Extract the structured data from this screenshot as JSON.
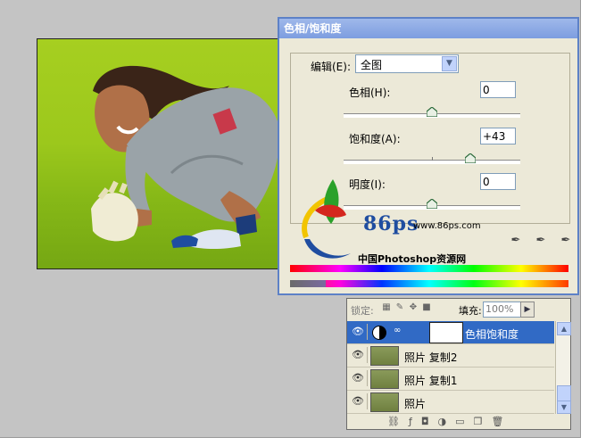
{
  "dialog": {
    "title": "色相/饱和度",
    "edit_label": "编辑(E):",
    "edit_value": "全图",
    "hue_label": "色相(H):",
    "hue_value": "0",
    "hue_level": 0,
    "saturation_label": "饱和度(A):",
    "saturation_value": "+43",
    "saturation_level": 43,
    "lightness_label": "明度(I):",
    "lightness_value": "0",
    "lightness_level": 0
  },
  "watermark": {
    "brand": "86ps",
    "url": "www.86ps.com",
    "tagline": "中国Photoshop资源网"
  },
  "layers_panel": {
    "lock_label": "锁定:",
    "fill_label": "填充:",
    "fill_value": "100%",
    "layers": [
      {
        "name": "色相饱和度",
        "selected": true,
        "type": "adjustment"
      },
      {
        "name": "照片 复制2",
        "selected": false,
        "type": "image"
      },
      {
        "name": "照片 复制1",
        "selected": false,
        "type": "image"
      },
      {
        "name": "照片",
        "selected": false,
        "type": "image"
      }
    ]
  },
  "colors": {
    "title_bar": "#7d9de0",
    "selection": "#316ac5",
    "panel_bg": "#ece9d8",
    "grass": "#a6cf20"
  }
}
